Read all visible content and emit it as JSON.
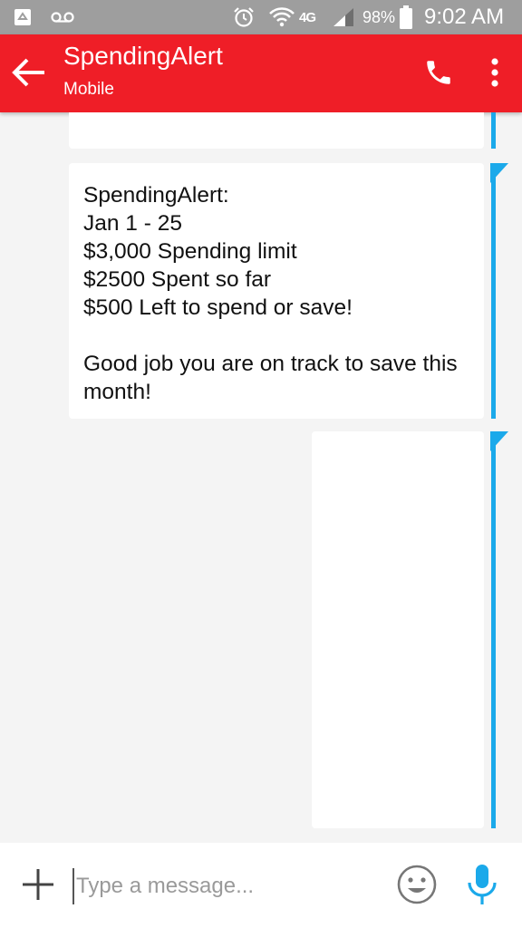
{
  "status_bar": {
    "network": "4G",
    "battery_percent": "98%",
    "time": "9:02 AM",
    "icons": [
      "recycle-icon",
      "voicemail-icon",
      "alarm-icon",
      "wifi-icon",
      "signal-icon",
      "battery-icon"
    ]
  },
  "header": {
    "contact_name": "SpendingAlert",
    "contact_type": "Mobile",
    "icons": [
      "back-arrow-icon",
      "phone-icon",
      "more-vert-icon"
    ]
  },
  "messages": [
    {
      "text": ""
    },
    {
      "text": "SpendingAlert:\nJan 1 - 25\n$3,000 Spending limit\n$2500 Spent so far\n$500 Left to spend or save!\n\nGood job you are on track to save this month!"
    },
    {
      "text": ""
    }
  ],
  "compose": {
    "placeholder": "Type a message...",
    "value": "",
    "icons": [
      "plus-icon",
      "emoji-icon",
      "mic-icon"
    ]
  },
  "colors": {
    "app_bar": "#ef1e27",
    "status_bar": "#9e9e9e",
    "accent": "#1ba9ea",
    "background": "#f4f4f4"
  }
}
